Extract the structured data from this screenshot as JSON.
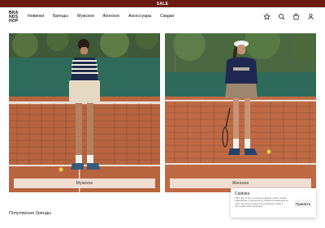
{
  "topbar": {
    "text": "SALE"
  },
  "logo": {
    "lines": [
      "BRA",
      "NDS",
      "HOP"
    ]
  },
  "nav": {
    "items": [
      "Новинки",
      "Бренды",
      "Мужское",
      "Женское",
      "Аксессуары",
      "Скидки"
    ]
  },
  "header_icons": [
    "star-icon",
    "search-icon",
    "bag-icon",
    "user-icon"
  ],
  "cards": [
    {
      "label": "Мужское"
    },
    {
      "label": "Женское"
    }
  ],
  "section": {
    "title": "Популярные бренды"
  },
  "cookie": {
    "title": "Cookies",
    "text": "ООО «Бр. Сторе» использует файлы cookie. Полная информация о принципах их обработки размещена на сайте. Вы можете запретить сохранение cookie в настройках своего браузера.",
    "accept": "Принять"
  },
  "colors": {
    "sale_bar": "#6b1a12",
    "card_button": "#f5e8de"
  }
}
